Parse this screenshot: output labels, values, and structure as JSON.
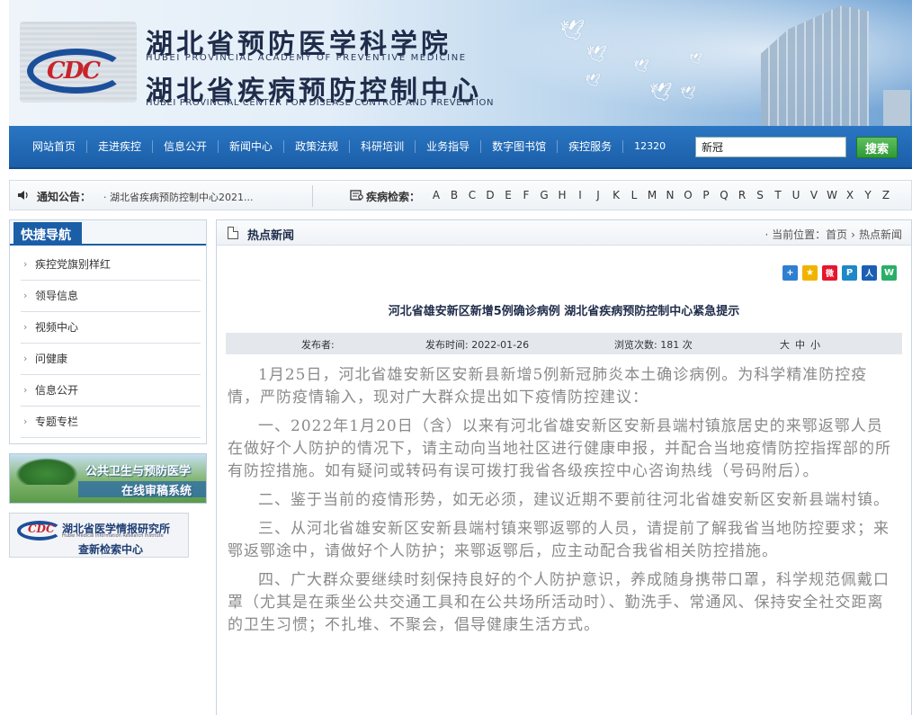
{
  "header": {
    "title_cn1": "湖北省预防医学科学院",
    "title_en1": "HUBEI PROVINCIAL ACADEMY OF PREVENTIVE MEDICINE",
    "title_cn2": "湖北省疾病预防控制中心",
    "title_en2": "HUBEI PROVINCIAL CENTER FOR DISEASE CONTROL AND PREVENTION",
    "logo_text": "CDC"
  },
  "nav": {
    "items": [
      "网站首页",
      "走进疾控",
      "信息公开",
      "新闻中心",
      "政策法规",
      "科研培训",
      "业务指导",
      "数字图书馆",
      "疾控服务",
      "12320"
    ],
    "search_value": "新冠",
    "search_button": "搜索"
  },
  "notice": {
    "label": "通知公告：",
    "text": "· 湖北省疾病预防控制中心2021...",
    "disease_label": "疾病检索：",
    "letters": [
      "A",
      "B",
      "C",
      "D",
      "E",
      "F",
      "G",
      "H",
      "I",
      "J",
      "K",
      "L",
      "M",
      "N",
      "O",
      "P",
      "Q",
      "R",
      "S",
      "T",
      "U",
      "V",
      "W",
      "X",
      "Y",
      "Z"
    ]
  },
  "sidebar": {
    "title": "快捷导航",
    "items": [
      "疾控党旗别样红",
      "领导信息",
      "视频中心",
      "问健康",
      "信息公开",
      "专题专栏"
    ],
    "banner1_line1": "公共卫生与预防医学",
    "banner1_line2": "在线审稿系统",
    "banner2_line1": "湖北省医学情报研究所",
    "banner2_line2": "Hubei Medical Information Research Institute",
    "banner2_line3": "查新检索中心"
  },
  "main": {
    "section_title": "热点新闻",
    "breadcrumb_label": "当前位置：",
    "breadcrumb_home": "首页",
    "breadcrumb_current": "热点新闻",
    "share_icons": [
      {
        "name": "share-plus-icon",
        "color": "#2f7fd1",
        "glyph": "+"
      },
      {
        "name": "share-qzone-icon",
        "color": "#f0b400",
        "glyph": "★"
      },
      {
        "name": "share-weibo-icon",
        "color": "#e6162d",
        "glyph": "微"
      },
      {
        "name": "share-tencent-icon",
        "color": "#1e88c8",
        "glyph": "P"
      },
      {
        "name": "share-renren-icon",
        "color": "#1a5fb4",
        "glyph": "人"
      },
      {
        "name": "share-wechat-icon",
        "color": "#2aae67",
        "glyph": "W"
      }
    ],
    "article_title": "河北省雄安新区新增5例确诊病例 湖北省疾病预防控制中心紧急提示",
    "meta": {
      "publisher_label": "发布者:",
      "date_label": "发布时间: 2022-01-26",
      "views_label": "浏览次数: 181 次",
      "size_large": "大",
      "size_medium": "中",
      "size_small": "小"
    },
    "paragraphs": [
      "1月25日，河北省雄安新区安新县新增5例新冠肺炎本土确诊病例。为科学精准防控疫情，严防疫情输入，现对广大群众提出如下疫情防控建议：",
      "一、2022年1月20日（含）以来有河北省雄安新区安新县端村镇旅居史的来鄂返鄂人员在做好个人防护的情况下，请主动向当地社区进行健康申报，并配合当地疫情防控指挥部的所有防控措施。如有疑问或转码有误可拨打我省各级疾控中心咨询热线（号码附后）。",
      "二、鉴于当前的疫情形势，如无必须，建议近期不要前往河北省雄安新区安新县端村镇。",
      "三、从河北省雄安新区安新县端村镇来鄂返鄂的人员，请提前了解我省当地防控要求；来鄂返鄂途中，请做好个人防护；来鄂返鄂后，应主动配合我省相关防控措施。",
      "四、广大群众要继续时刻保持良好的个人防护意识，养成随身携带口罩，科学规范佩戴口罩（尤其是在乘坐公共交通工具和在公共场所活动时）、勤洗手、常通风、保持安全社交距离的卫生习惯；不扎堆、不聚会，倡导健康生活方式。"
    ]
  }
}
